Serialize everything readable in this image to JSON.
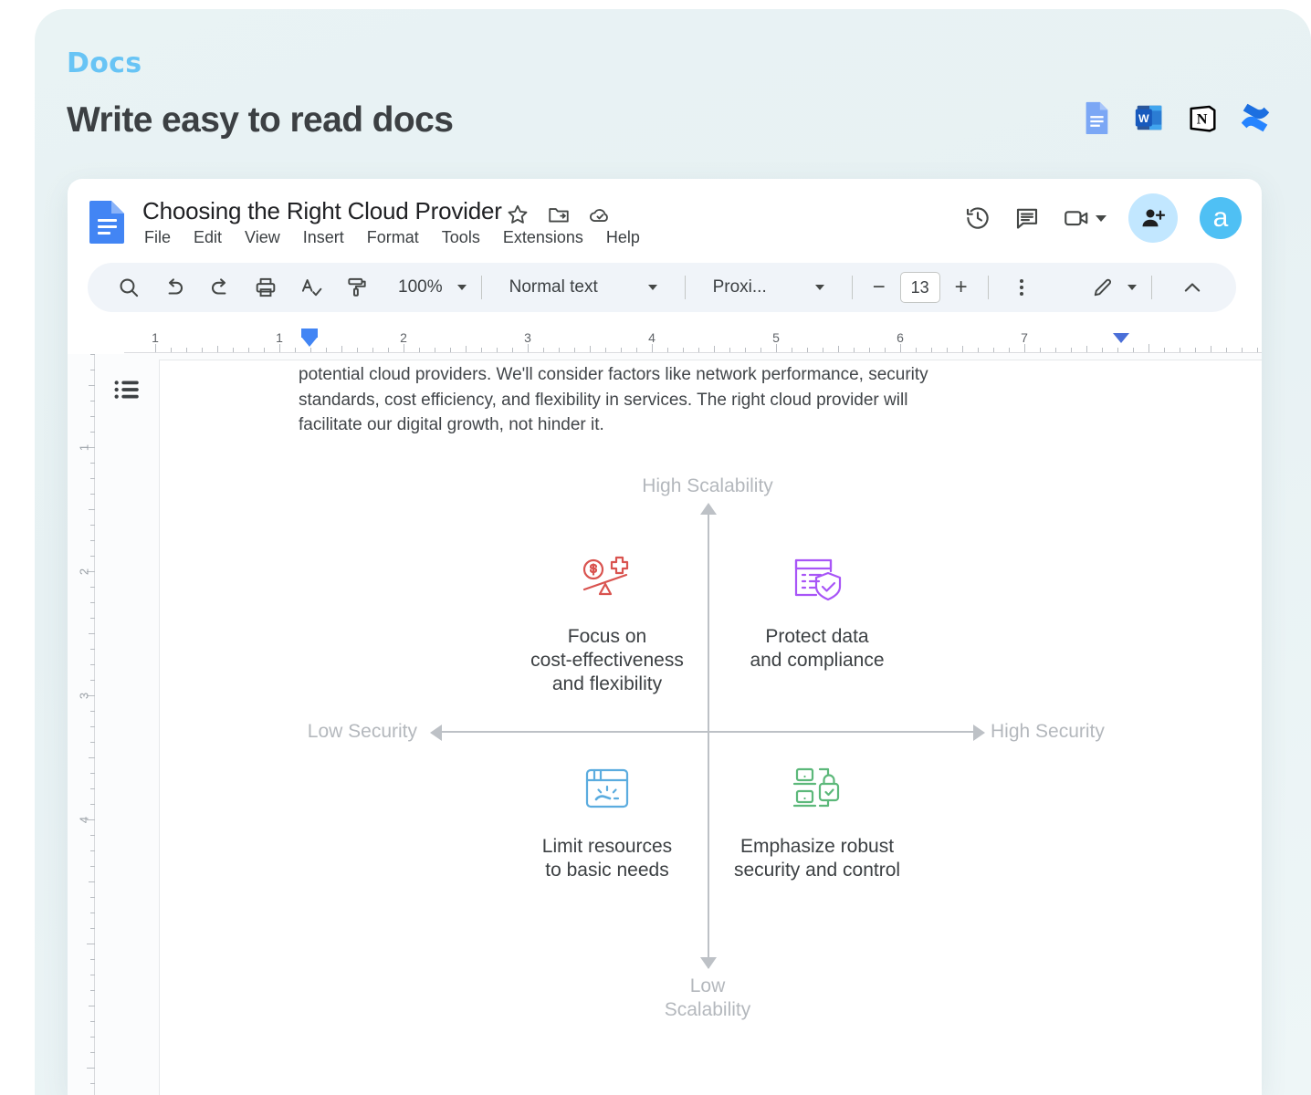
{
  "promo": {
    "eyebrow": "Docs",
    "title": "Write easy to read docs",
    "app_icons": [
      {
        "name": "google-docs-icon",
        "label": "Google Docs"
      },
      {
        "name": "microsoft-word-icon",
        "label": "Microsoft Word"
      },
      {
        "name": "notion-icon",
        "label": "Notion"
      },
      {
        "name": "confluence-icon",
        "label": "Confluence"
      }
    ]
  },
  "doc": {
    "title": "Choosing the Right Cloud Provider",
    "menu": [
      "File",
      "Edit",
      "View",
      "Insert",
      "Format",
      "Tools",
      "Extensions",
      "Help"
    ],
    "title_actions": [
      "star-icon",
      "move-to-folder-icon",
      "cloud-saved-icon"
    ],
    "header_actions": [
      "version-history-icon",
      "comment-icon",
      "video-camera-icon"
    ],
    "avatar_letter": "a"
  },
  "toolbar": {
    "zoom": "100%",
    "paragraph_style": "Normal text",
    "font": "Proxi...",
    "font_size": "13",
    "icons": [
      "search-icon",
      "undo-icon",
      "redo-icon",
      "print-icon",
      "spellcheck-icon",
      "paint-format-icon"
    ],
    "more_label": "more-options",
    "mode_icon": "edit-pencil-icon",
    "collapse_icon": "chevron-up-icon"
  },
  "ruler": {
    "horizontal_numbers": [
      "1",
      "1",
      "2",
      "3",
      "4",
      "5",
      "6",
      "7"
    ],
    "vertical_numbers": [
      "1",
      "2",
      "3",
      "4"
    ]
  },
  "document": {
    "body_paragraph": "potential cloud providers. We'll consider factors like network performance, security standards, cost efficiency, and flexibility in services. The right cloud provider will facilitate our digital growth, not hinder it."
  },
  "chart_data": {
    "type": "scatter",
    "title": "",
    "xlabel": "Security",
    "ylabel": "Scalability",
    "axis_labels": {
      "top": "High Scalability",
      "bottom": "Low\nScalability",
      "bottom_line1": "Low",
      "bottom_line2": "Scalability",
      "left": "Low Security",
      "right": "High Security"
    },
    "quadrants": [
      {
        "position": "top-left",
        "label_line1": "Focus on",
        "label_line2": "cost-effectiveness",
        "label_line3": "and flexibility",
        "icon": "cost-balance-scale-icon",
        "color": "#d9534f"
      },
      {
        "position": "top-right",
        "label_line1": "Protect data",
        "label_line2": "and compliance",
        "label_line3": "",
        "icon": "compliance-shield-document-icon",
        "color": "#a855f7"
      },
      {
        "position": "bottom-left",
        "label_line1": "Limit resources",
        "label_line2": "to basic needs",
        "label_line3": "",
        "icon": "browser-gauge-icon",
        "color": "#5bacdf"
      },
      {
        "position": "bottom-right",
        "label_line1": "Emphasize robust",
        "label_line2": "security and control",
        "label_line3": "",
        "icon": "laptops-padlock-icon",
        "color": "#5cb87a"
      }
    ]
  },
  "colors": {
    "accent_blue": "#68c4f5",
    "docs_blue": "#4285f4",
    "background": "#e9f3f4"
  }
}
